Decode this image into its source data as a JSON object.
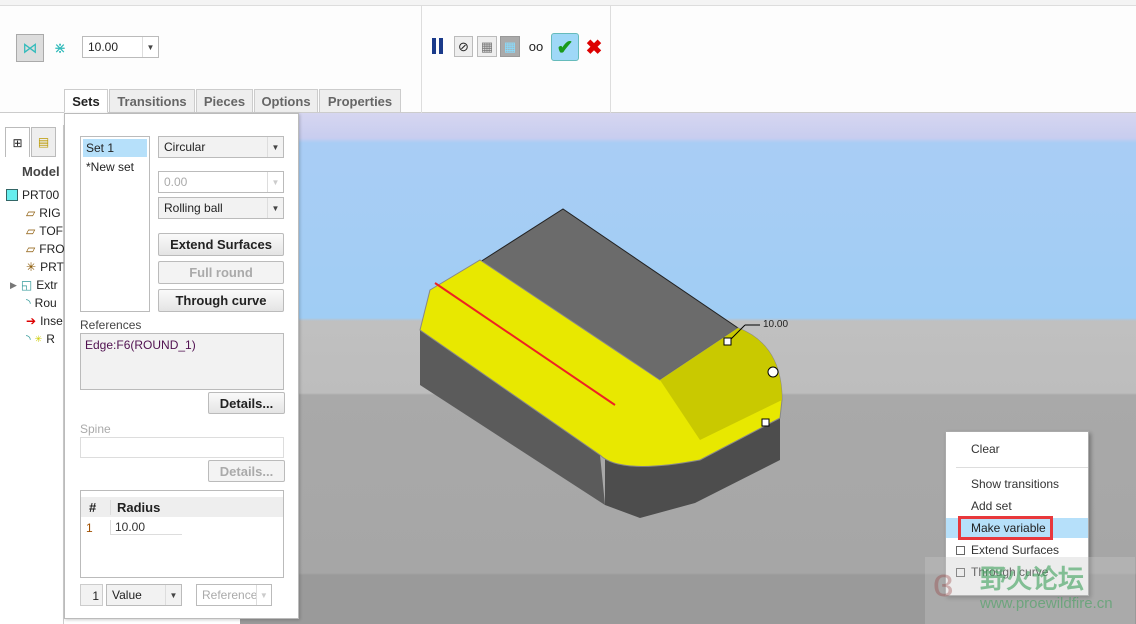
{
  "toolbar": {
    "radius_value": "10.00",
    "pause_icon": "pause-icon",
    "ok_icon": "check-icon",
    "cancel_icon": "x-icon"
  },
  "tabs": [
    "Sets",
    "Transitions",
    "Pieces",
    "Options",
    "Properties"
  ],
  "sets": {
    "items": [
      "Set 1",
      "*New set"
    ],
    "shape": "Circular",
    "value": "0.00",
    "method": "Rolling ball",
    "extend_surfaces": "Extend Surfaces",
    "full_round": "Full round",
    "through_curve": "Through curve",
    "references_label": "References",
    "reference": "Edge:F6(ROUND_1)",
    "details": "Details...",
    "spine_label": "Spine",
    "spine_details": "Details...",
    "table": {
      "headers": [
        "#",
        "Radius"
      ],
      "rows": [
        [
          "1",
          "10.00"
        ]
      ]
    },
    "row_index": "1",
    "value_mode": "Value",
    "reference_mode": "Reference"
  },
  "tree": {
    "header": "Model",
    "items": [
      "PRT00",
      "RIG",
      "TOF",
      "FRO",
      "PRT",
      "Extr",
      "Rou",
      "Inse",
      "R"
    ]
  },
  "viewport": {
    "dimension": "10.00"
  },
  "context_menu": {
    "items": [
      "Clear",
      "Show transitions",
      "Add set",
      "Make variable",
      "Extend Surfaces",
      "Through curve"
    ],
    "highlighted": "Make variable",
    "highlight_color": "#e8383c"
  },
  "watermark": {
    "cn": "野火论坛",
    "url": "www.proewildfire.cn"
  }
}
